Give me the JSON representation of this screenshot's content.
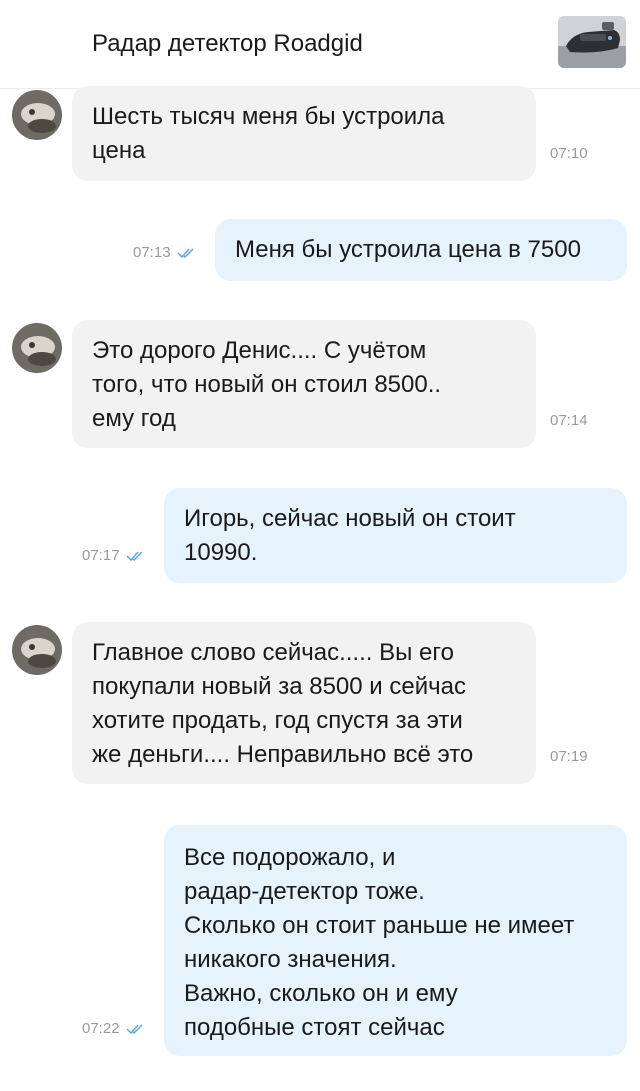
{
  "header": {
    "title": "Радар детектор Roadgid",
    "product_thumb_icon": "radar-detector-photo"
  },
  "messages": [
    {
      "direction": "in",
      "text": "Шесть тысяч меня бы устроила\nцена",
      "time": "07:10"
    },
    {
      "direction": "out",
      "text": "Меня бы устроила цена в 7500",
      "time": "07:13",
      "status": "read"
    },
    {
      "direction": "in",
      "text": "Это дорого Денис.... С учётом\nтого, что новый он стоил 8500..\nему год",
      "time": "07:14"
    },
    {
      "direction": "out",
      "text": "Игорь, сейчас новый он стоит\n10990.",
      "time": "07:17",
      "status": "read"
    },
    {
      "direction": "in",
      "text": "Главное слово сейчас..... Вы его\nпокупали новый за 8500 и сейчас\nхотите продать, год спустя за эти\nже деньги.... Неправильно всё это",
      "time": "07:19"
    },
    {
      "direction": "out",
      "text": "Все подорожало, и\nрадар-детектор тоже.\nСколько он стоит раньше не имеет\nникакого значения.\nВажно, сколько он и ему\nподобные стоят сейчас",
      "time": "07:22",
      "status": "read"
    }
  ],
  "colors": {
    "incoming_bubble": "#f2f2f2",
    "outgoing_bubble": "#e6f3fd",
    "read_ticks": "#5aa9e6",
    "timestamp": "#9a9a9a"
  }
}
